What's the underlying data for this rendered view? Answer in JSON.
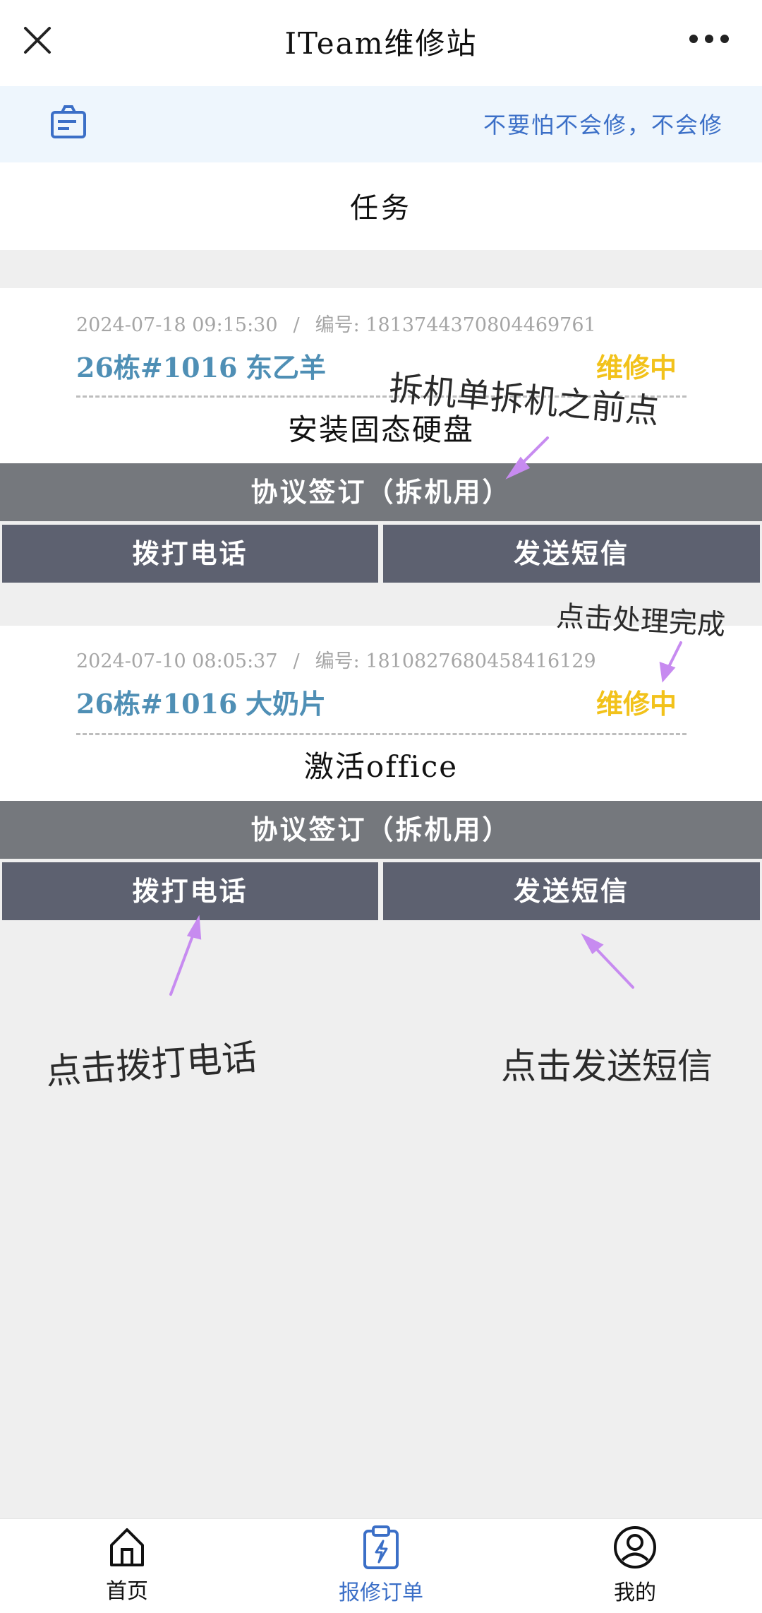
{
  "header": {
    "title": "ITeam维修站"
  },
  "notice": {
    "text": "不要怕不会修，不会修"
  },
  "tab": {
    "label": "任务"
  },
  "orders": [
    {
      "datetime": "2024-07-18 09:15:30",
      "separator": "/",
      "order_no": "编号: 1813744370804469761",
      "location": "26栋#1016",
      "customer": "东乙羊",
      "status": "维修中",
      "description": "安装固态硬盘",
      "agreement_button": "协议签订（拆机用）",
      "call_button": "拨打电话",
      "sms_button": "发送短信"
    },
    {
      "datetime": "2024-07-10 08:05:37",
      "separator": "/",
      "order_no": "编号: 1810827680458416129",
      "location": "26栋#1016",
      "customer": "大奶片",
      "status": "维修中",
      "description": "激活office",
      "agreement_button": "协议签订（拆机用）",
      "call_button": "拨打电话",
      "sms_button": "发送短信"
    }
  ],
  "annotations": {
    "before_disassembly": "拆机单拆机之前点",
    "complete": "点击处理完成",
    "call": "点击拨打电话",
    "sms": "点击发送短信"
  },
  "bottom_nav": {
    "items": [
      {
        "label": "首页",
        "icon": "home-icon",
        "active": false
      },
      {
        "label": "报修订单",
        "icon": "clipboard-bolt-icon",
        "active": true
      },
      {
        "label": "我的",
        "icon": "user-icon",
        "active": false
      }
    ]
  },
  "colors": {
    "accent_blue": "#3b6fc7",
    "location_blue": "#4f8fb5",
    "status_yellow": "#f2c21b",
    "button_gray": "#75787d",
    "button_dark": "#5d6170",
    "annotation_purple": "#c78bf0"
  }
}
